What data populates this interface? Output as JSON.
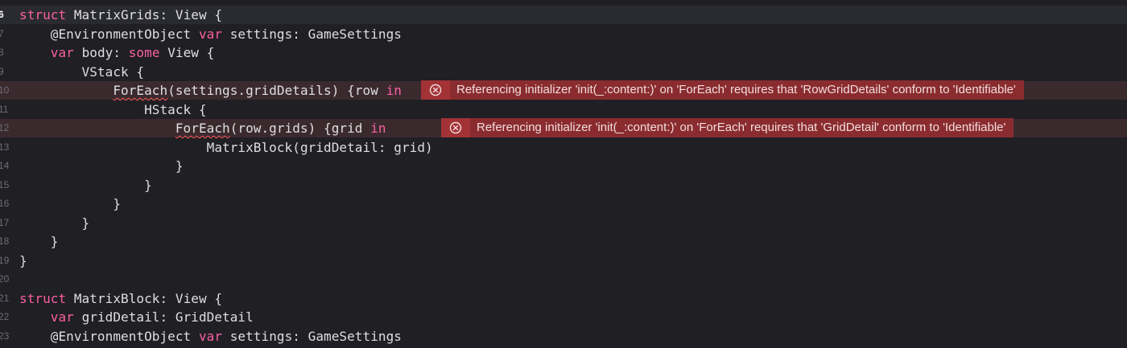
{
  "colors": {
    "background": "#1f1f24",
    "current_line": "#2a2b31",
    "error_line": "#3a2a2e",
    "keyword": "#fc5fa3",
    "type": "#d0a8ff",
    "plain": "#dfdfe0",
    "error_banner": "#8a2c2f",
    "error_icon_bg": "#a23236"
  },
  "lines": [
    {
      "num": "6",
      "tokens": [
        {
          "t": "struct",
          "c": "kw"
        },
        {
          "t": " MatrixGrids: ",
          "c": "plain"
        },
        {
          "t": "View",
          "c": "plain"
        },
        {
          "t": " {",
          "c": "plain"
        }
      ]
    },
    {
      "num": "7",
      "tokens": [
        {
          "t": "    @EnvironmentObject ",
          "c": "plain"
        },
        {
          "t": "var",
          "c": "kw"
        },
        {
          "t": " settings: GameSettings",
          "c": "plain"
        }
      ]
    },
    {
      "num": "8",
      "tokens": [
        {
          "t": "    ",
          "c": "plain"
        },
        {
          "t": "var",
          "c": "kw"
        },
        {
          "t": " body: ",
          "c": "plain"
        },
        {
          "t": "some",
          "c": "kw"
        },
        {
          "t": " View {",
          "c": "plain"
        }
      ]
    },
    {
      "num": "9",
      "tokens": [
        {
          "t": "        VStack {",
          "c": "plain"
        }
      ]
    },
    {
      "num": "10",
      "tokens": [
        {
          "t": "            ",
          "c": "plain"
        },
        {
          "t": "ForEach",
          "c": "plain"
        },
        {
          "t": "(settings.gridDetails) {row ",
          "c": "plain"
        },
        {
          "t": "in",
          "c": "kw"
        }
      ]
    },
    {
      "num": "11",
      "tokens": [
        {
          "t": "                HStack {",
          "c": "plain"
        }
      ]
    },
    {
      "num": "12",
      "tokens": [
        {
          "t": "                    ",
          "c": "plain"
        },
        {
          "t": "ForEach",
          "c": "plain"
        },
        {
          "t": "(row.grids) {grid ",
          "c": "plain"
        },
        {
          "t": "in",
          "c": "kw"
        }
      ]
    },
    {
      "num": "13",
      "tokens": [
        {
          "t": "                        MatrixBlock(gridDetail: grid)",
          "c": "plain"
        }
      ]
    },
    {
      "num": "14",
      "tokens": [
        {
          "t": "                    }",
          "c": "plain"
        }
      ]
    },
    {
      "num": "15",
      "tokens": [
        {
          "t": "                }",
          "c": "plain"
        }
      ]
    },
    {
      "num": "16",
      "tokens": [
        {
          "t": "            }",
          "c": "plain"
        }
      ]
    },
    {
      "num": "17",
      "tokens": [
        {
          "t": "        }",
          "c": "plain"
        }
      ]
    },
    {
      "num": "18",
      "tokens": [
        {
          "t": "    }",
          "c": "plain"
        }
      ]
    },
    {
      "num": "19",
      "tokens": [
        {
          "t": "}",
          "c": "plain"
        }
      ]
    },
    {
      "num": "20",
      "tokens": []
    },
    {
      "num": "21",
      "tokens": [
        {
          "t": "struct",
          "c": "kw"
        },
        {
          "t": " MatrixBlock: View {",
          "c": "plain"
        }
      ]
    },
    {
      "num": "22",
      "tokens": [
        {
          "t": "    ",
          "c": "plain"
        },
        {
          "t": "var",
          "c": "kw"
        },
        {
          "t": " gridDetail: GridDetail",
          "c": "plain"
        }
      ]
    },
    {
      "num": "23",
      "tokens": [
        {
          "t": "    @EnvironmentObject ",
          "c": "plain"
        },
        {
          "t": "var",
          "c": "kw"
        },
        {
          "t": " settings: GameSettings",
          "c": "plain"
        }
      ]
    }
  ],
  "errors": {
    "row_error": "Referencing initializer 'init(_:content:)' on 'ForEach' requires that 'RowGridDetails' conform to 'Identifiable'",
    "grid_error": "Referencing initializer 'init(_:content:)' on 'ForEach' requires that 'GridDetail' conform to 'Identifiable'"
  },
  "icons": {
    "error_icon": "error-circle-x-icon"
  }
}
